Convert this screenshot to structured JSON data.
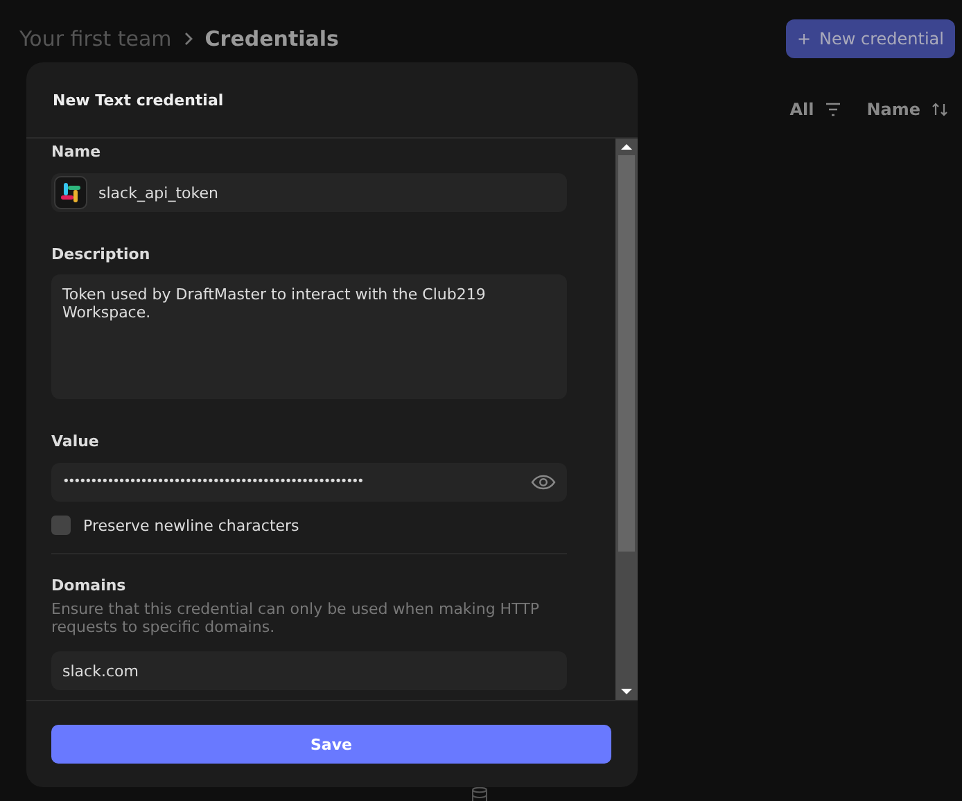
{
  "breadcrumb": [
    {
      "label": "Your first team",
      "selected": false
    },
    {
      "label": "Credentials",
      "selected": true
    }
  ],
  "new_button": {
    "icon": "+",
    "label": "New credential"
  },
  "list_controls": {
    "filter": "All",
    "sort": "Name"
  },
  "dialog": {
    "title": "New Text credential",
    "name": {
      "label": "Name",
      "value": "slack_api_token"
    },
    "description": {
      "label": "Description",
      "value": "Token used by DraftMaster to interact with the Club219 Workspace."
    },
    "value": {
      "label": "Value",
      "masked": "••••••••••••••••••••••••••••••••••••••••••••••••••••••"
    },
    "preserve_newlines": {
      "label": "Preserve newline characters",
      "checked": false
    },
    "domains": {
      "label": "Domains",
      "help": "Ensure that this credential can only be used when making HTTP requests to specific domains.",
      "value": "slack.com"
    },
    "save_button": "Save"
  }
}
